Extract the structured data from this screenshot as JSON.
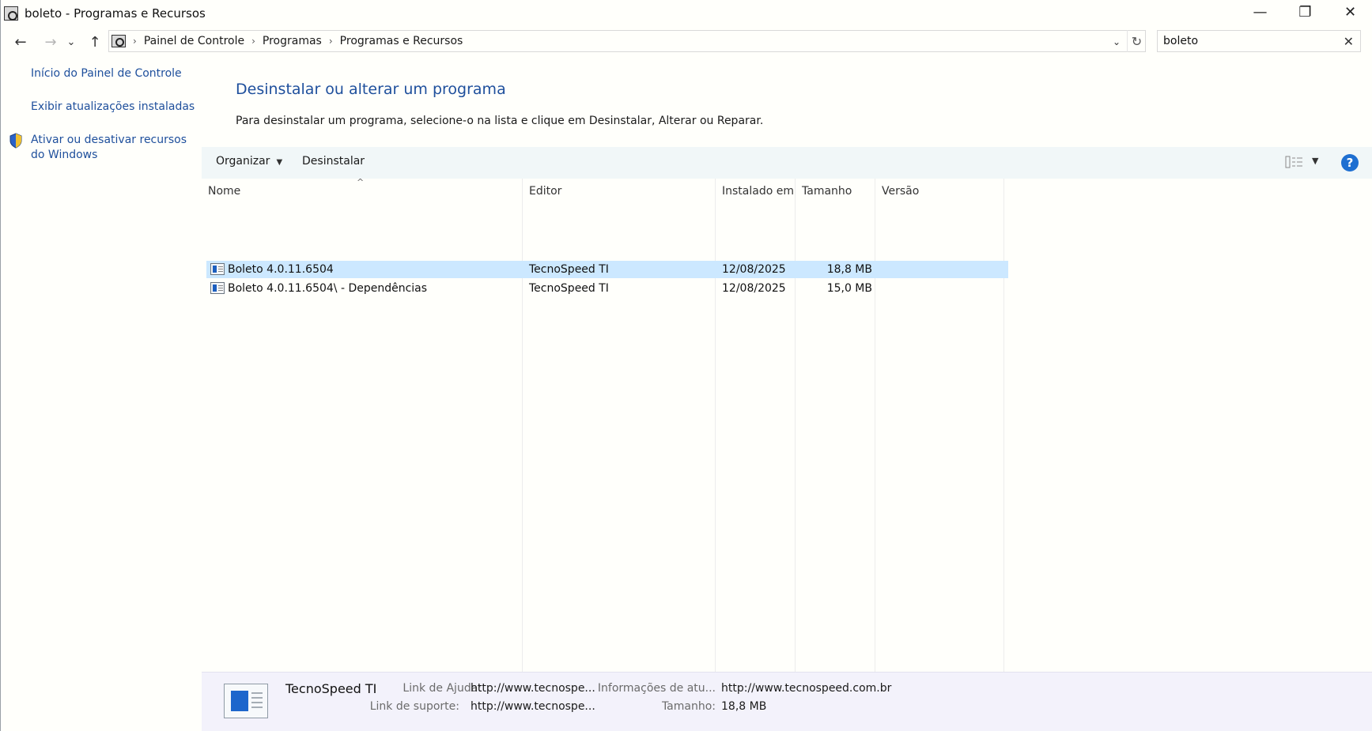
{
  "window": {
    "title": "boleto - Programas e Recursos",
    "controls": {
      "minimize": "—",
      "restore": "❐",
      "close": "✕"
    }
  },
  "nav": {
    "back": "←",
    "forward": "→",
    "recent": "⌄",
    "up": "↑",
    "breadcrumbs": [
      "Painel de Controle",
      "Programas",
      "Programas e Recursos"
    ],
    "search_value": "boleto"
  },
  "sidebar": {
    "links": [
      {
        "label": "Início do Painel de Controle"
      },
      {
        "label": "Exibir atualizações instaladas"
      },
      {
        "label": "Ativar ou desativar recursos do Windows"
      }
    ]
  },
  "main": {
    "heading": "Desinstalar ou alterar um programa",
    "subtext": "Para desinstalar um programa, selecione-o na lista e clique em Desinstalar, Alterar ou Reparar."
  },
  "toolbar": {
    "organize": "Organizar",
    "uninstall": "Desinstalar",
    "help": "?"
  },
  "table": {
    "columns": [
      "Nome",
      "Editor",
      "Instalado em",
      "Tamanho",
      "Versão"
    ],
    "rows": [
      {
        "name": "Boleto 4.0.11.6504",
        "publisher": "TecnoSpeed TI",
        "installed": "12/08/2025",
        "size": "18,8 MB",
        "version": "",
        "selected": true
      },
      {
        "name": "Boleto 4.0.11.6504\\ - Dependências",
        "publisher": "TecnoSpeed TI",
        "installed": "12/08/2025",
        "size": "15,0 MB",
        "version": "",
        "selected": false
      }
    ]
  },
  "details": {
    "publisher": "TecnoSpeed TI",
    "help_link_label": "Link de Ajuda:",
    "help_link_value": "http://www.tecnospe...",
    "update_info_label": "Informações de atu...",
    "update_info_value": "http://www.tecnospeed.com.br",
    "support_link_label": "Link de suporte:",
    "support_link_value": "http://www.tecnospe...",
    "size_label": "Tamanho:",
    "size_value": "18,8 MB"
  }
}
